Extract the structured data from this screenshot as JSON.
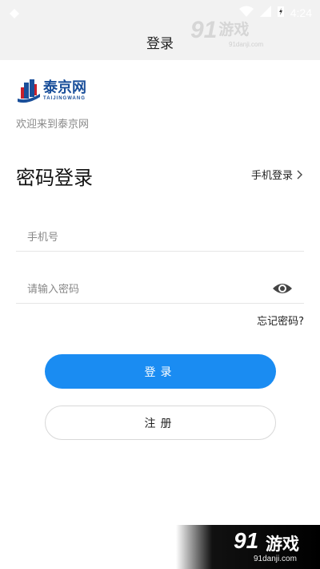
{
  "status_bar": {
    "time": "4:24"
  },
  "header": {
    "title": "登录"
  },
  "watermark": {
    "number": "91",
    "brand": "游戏",
    "domain": "91danji.com"
  },
  "logo": {
    "name": "泰京网",
    "subtitle": "TAIJINGWANG"
  },
  "welcome": "欢迎来到泰京网",
  "login": {
    "title": "密码登录",
    "switch_label": "手机登录",
    "phone_placeholder": "手机号",
    "password_placeholder": "请输入密码",
    "forgot": "忘记密码?",
    "login_button": "登录",
    "register_button": "注册"
  },
  "colors": {
    "primary": "#1a8cf2",
    "logo_blue": "#1a4f9a"
  }
}
